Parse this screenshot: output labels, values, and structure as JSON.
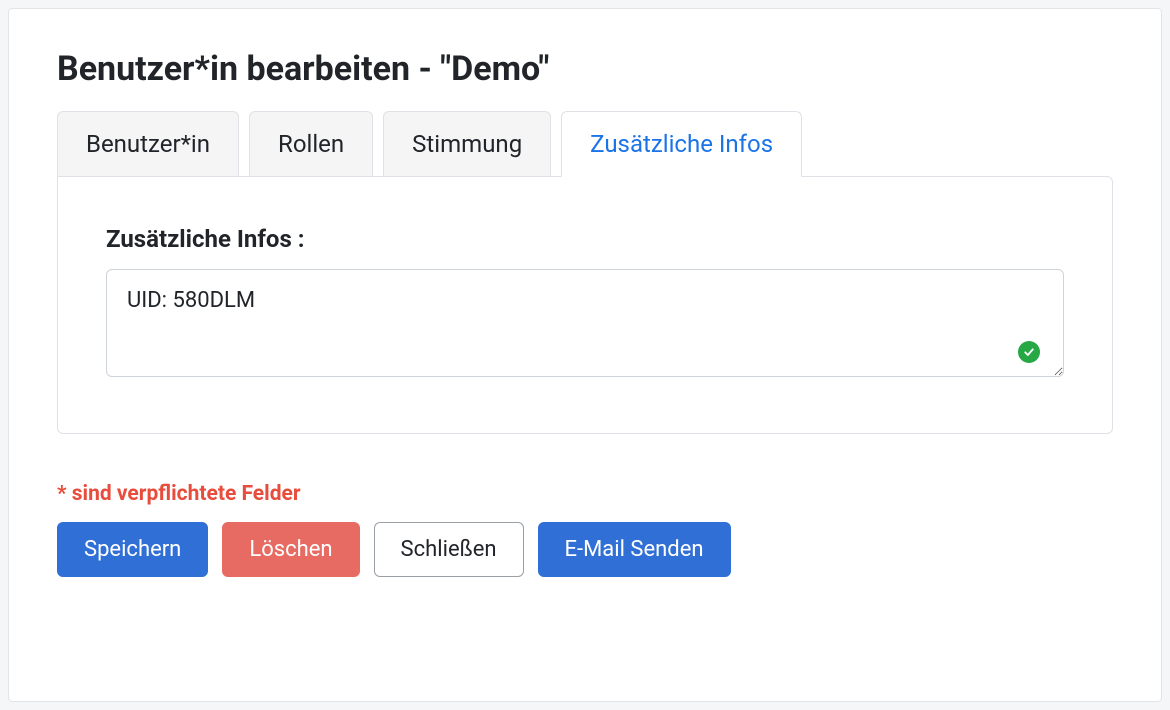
{
  "header": {
    "title": "Benutzer*in bearbeiten - \"Demo\""
  },
  "tabs": [
    {
      "label": "Benutzer*in",
      "active": false
    },
    {
      "label": "Rollen",
      "active": false
    },
    {
      "label": "Stimmung",
      "active": false
    },
    {
      "label": "Zusätzliche Infos",
      "active": true
    }
  ],
  "form": {
    "additionalInfo": {
      "label": "Zusätzliche Infos :",
      "value": "UID: 580DLM",
      "valid": true
    },
    "requiredNote": "* sind verpflichtete Felder"
  },
  "buttons": {
    "save": "Speichern",
    "delete": "Löschen",
    "close": "Schließen",
    "sendEmail": "E-Mail Senden"
  }
}
